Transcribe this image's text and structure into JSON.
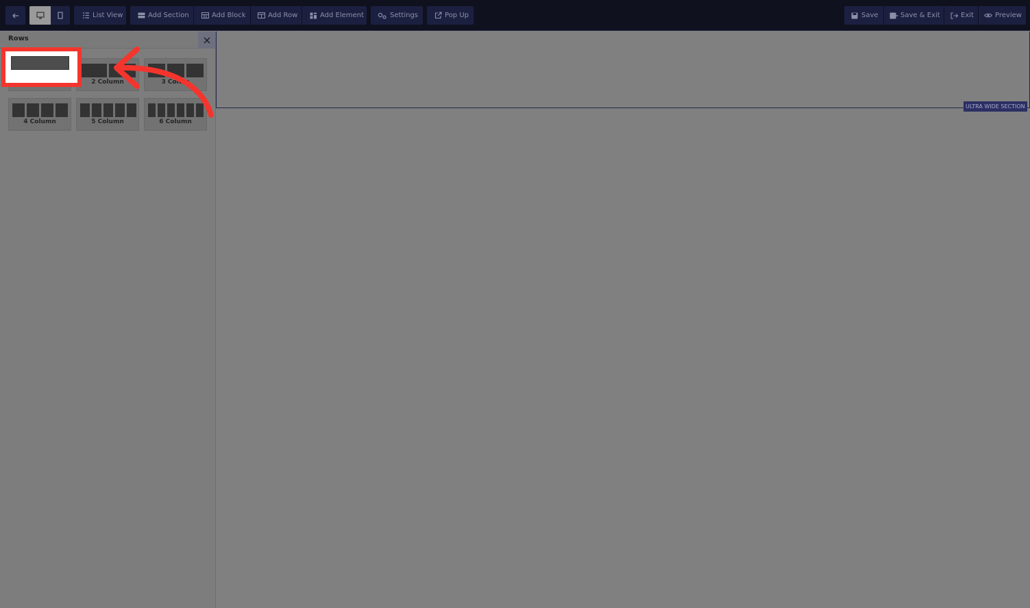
{
  "toolbar": {
    "back_icon": "arrow-left-icon",
    "desktop_icon": "monitor-icon",
    "mobile_icon": "mobile-icon",
    "list_view": "List View",
    "add_section": "Add Section",
    "add_block": "Add Block",
    "add_row": "Add Row",
    "add_element": "Add Element",
    "settings": "Settings",
    "pop_up": "Pop Up",
    "save": "Save",
    "save_exit": "Save & Exit",
    "exit": "Exit",
    "preview": "Preview"
  },
  "sidebar": {
    "title": "Rows",
    "tiles": [
      {
        "label": "",
        "columns": 1
      },
      {
        "label": "2 Column",
        "columns": 2
      },
      {
        "label": "3 Colum",
        "columns": 3
      },
      {
        "label": "4 Column",
        "columns": 4
      },
      {
        "label": "5 Column",
        "columns": 5
      },
      {
        "label": "6 Column",
        "columns": 6
      }
    ]
  },
  "canvas": {
    "section_tag": "ULTRA WIDE SECTION"
  },
  "colors": {
    "toolbar_bg": "#0f111f",
    "button_bg": "#1c2040",
    "highlight": "#f4352d",
    "overlay": "#808080"
  }
}
